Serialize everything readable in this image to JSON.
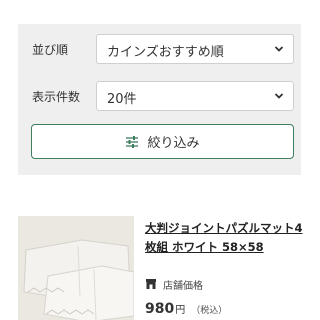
{
  "sort": {
    "label": "並び順",
    "value": "カインズおすすめ順",
    "chevron_icon": "chevron-down-icon"
  },
  "count": {
    "label": "表示件数",
    "value": "20件",
    "chevron_icon": "chevron-down-icon"
  },
  "filter": {
    "label": "絞り込み",
    "icon": "sliders-icon"
  },
  "product": {
    "title": "大判ジョイントパズルマット4枚組 ホワイト 58×58",
    "store_icon": "store-icon",
    "store_label": "店舗価格",
    "price": "980",
    "price_unit": "円",
    "price_tax": "（税込）"
  },
  "colors": {
    "panel_bg": "#efefef",
    "accent_green": "#3f7e5f",
    "text": "#333333"
  }
}
